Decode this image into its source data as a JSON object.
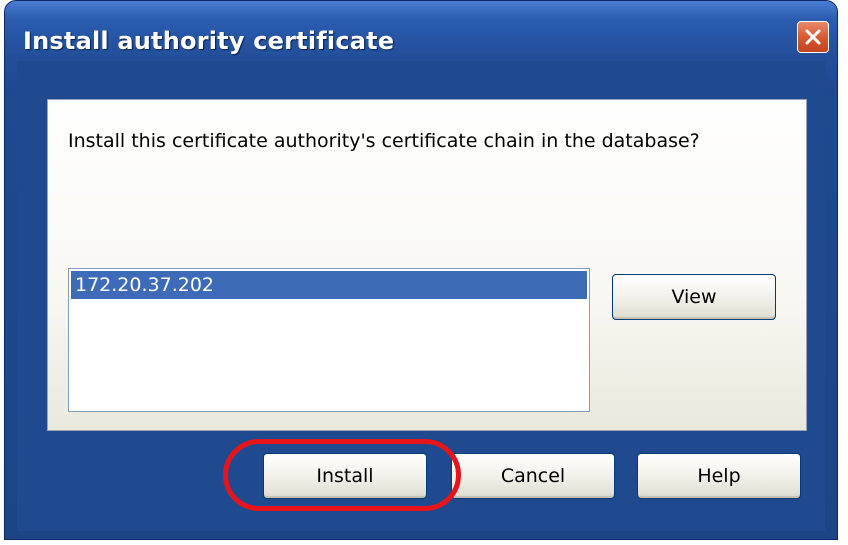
{
  "window": {
    "title": "Install authority certificate"
  },
  "dialog": {
    "prompt": "Install this certificate authority's certificate chain in the database?",
    "certificate_list": [
      "172.20.37.202"
    ],
    "selected_index": 0,
    "view_label": "View",
    "install_label": "Install",
    "cancel_label": "Cancel",
    "help_label": "Help"
  },
  "colors": {
    "title_bar": "#2a5cb0",
    "close_button": "#d85a32",
    "selection": "#3d6bb8",
    "highlight_annotation": "#e8141c"
  },
  "icons": {
    "close": "close-x-icon"
  }
}
